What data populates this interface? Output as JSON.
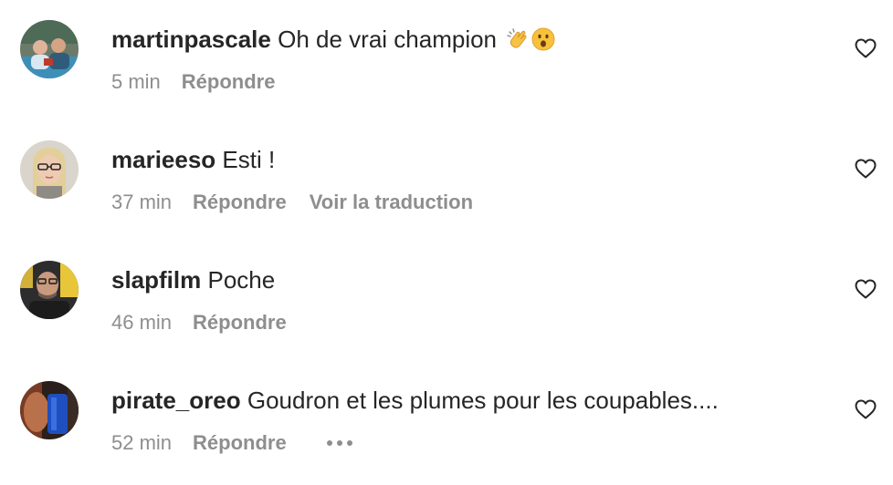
{
  "comments": [
    {
      "username": "martinpascale",
      "text": "Oh de vrai champion",
      "emojis": [
        "clapping-hands",
        "astonished-face"
      ],
      "time": "5 min",
      "reply_label": "Répondre"
    },
    {
      "username": "marieeso",
      "text": "Esti !",
      "time": "37 min",
      "reply_label": "Répondre",
      "translate_label": "Voir la traduction"
    },
    {
      "username": "slapfilm",
      "text": "Poche",
      "time": "46 min",
      "reply_label": "Répondre"
    },
    {
      "username": "pirate_oreo",
      "text": "Goudron et les plumes pour les coupables....",
      "time": "52 min",
      "reply_label": "Répondre",
      "more_icon": "more-horizontal-icon"
    }
  ],
  "icons": {
    "like": "heart-outline-icon"
  },
  "colors": {
    "text_primary": "#262626",
    "text_secondary": "#8e8e8e",
    "background": "#ffffff"
  }
}
